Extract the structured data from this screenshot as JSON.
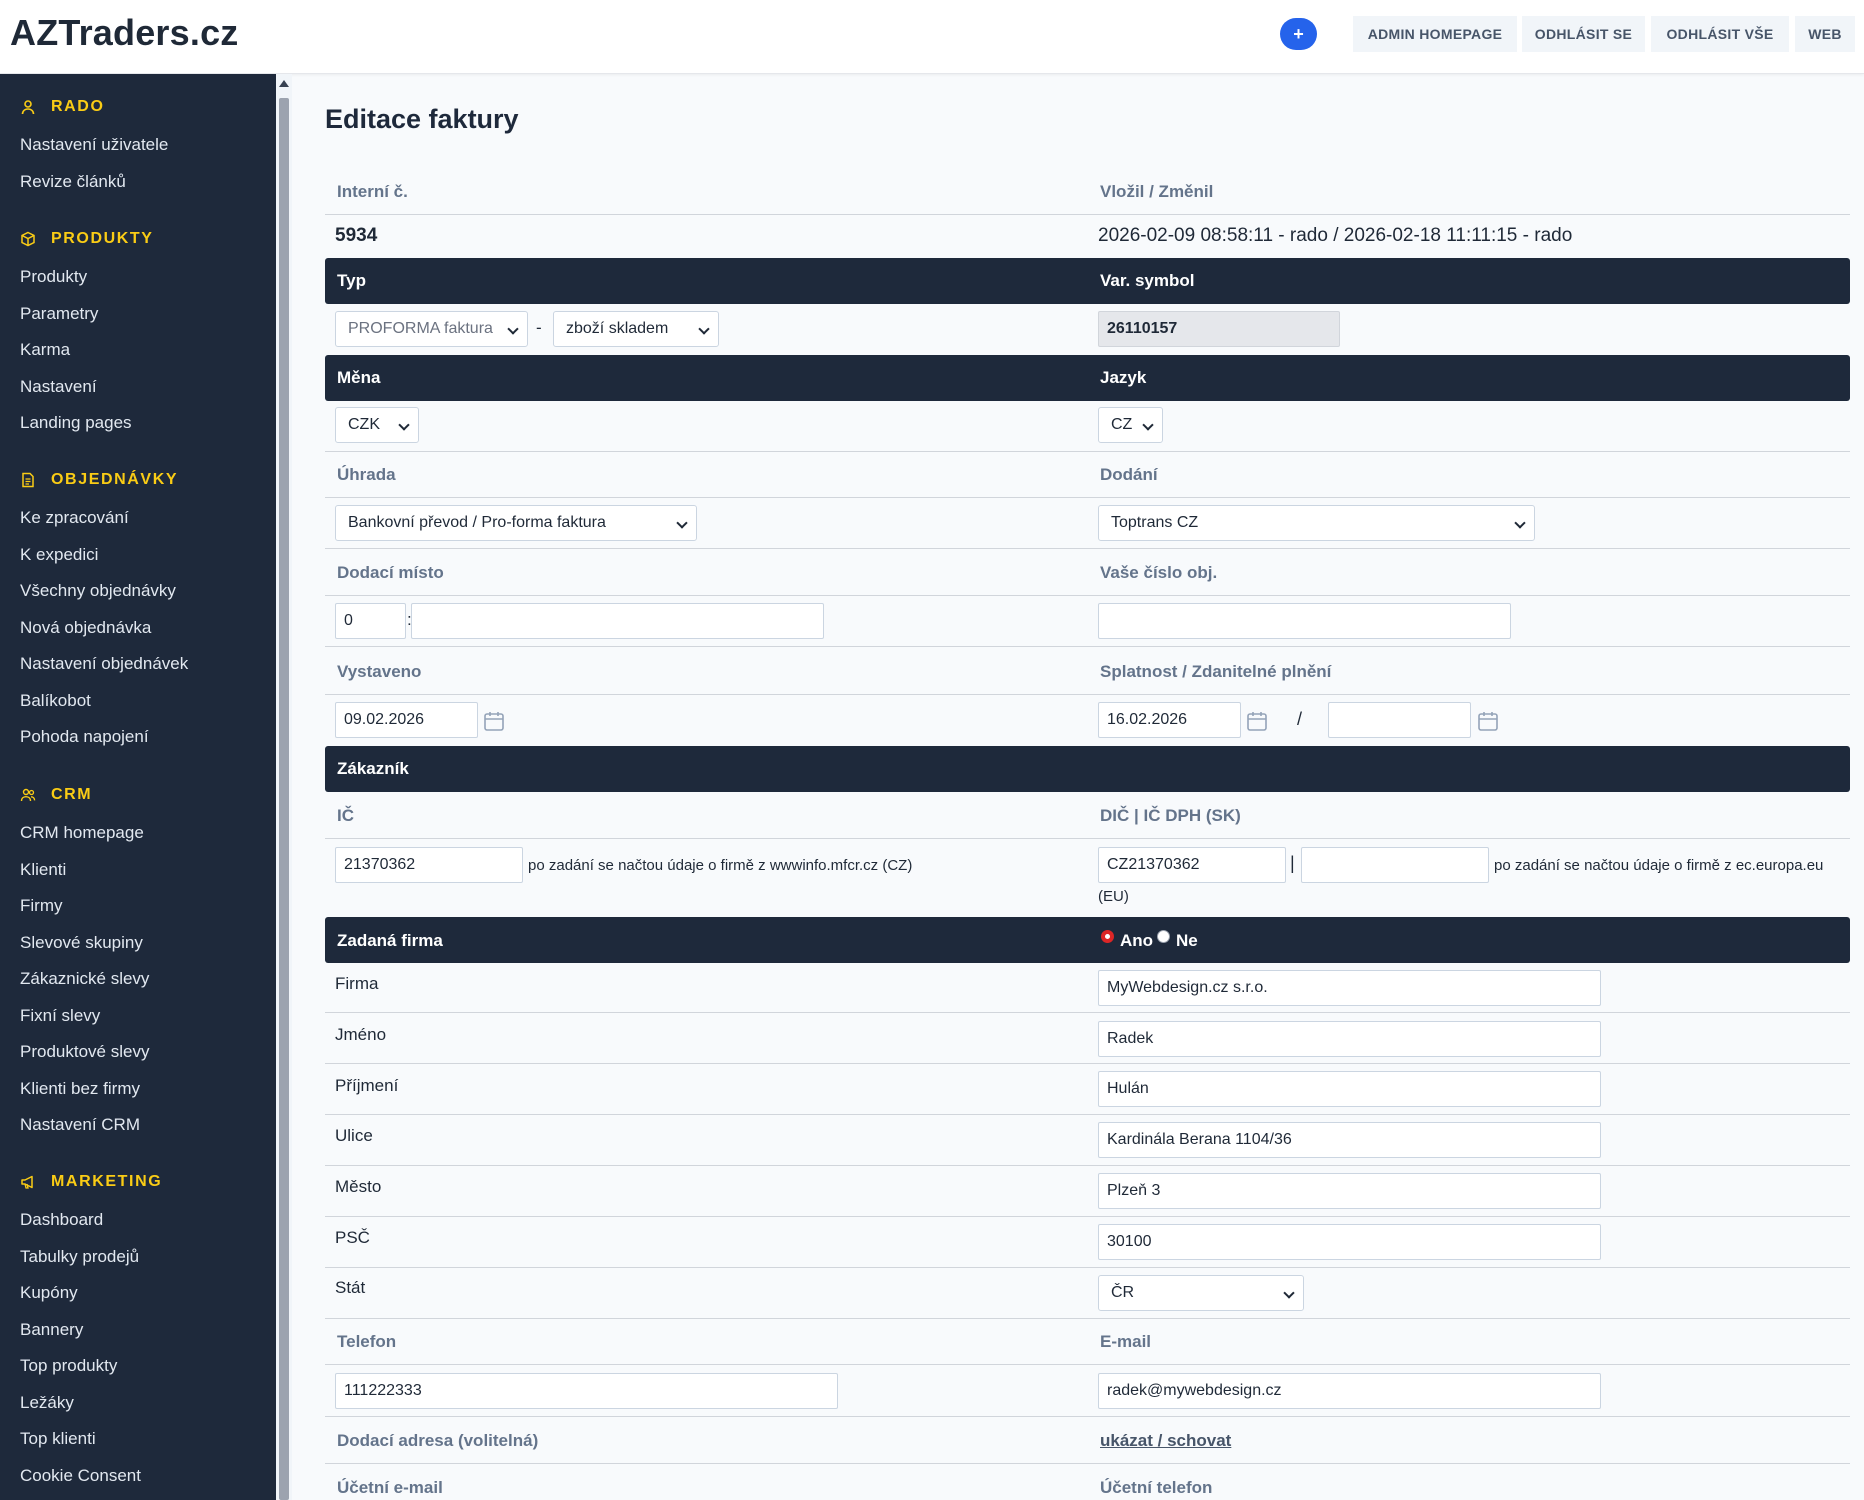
{
  "header": {
    "logo": "AZTraders.cz",
    "plus_label": "+",
    "links": [
      "ADMIN HOMEPAGE",
      "ODHLÁSIT SE",
      "ODHLÁSIT VŠE",
      "WEB"
    ]
  },
  "sidebar": {
    "sections": [
      {
        "title": "RADO",
        "icon": "user-icon",
        "items": [
          "Nastavení uživatele",
          "Revize článků"
        ]
      },
      {
        "title": "PRODUKTY",
        "icon": "box-icon",
        "items": [
          "Produkty",
          "Parametry",
          "Karma",
          "Nastavení",
          "Landing pages"
        ]
      },
      {
        "title": "OBJEDNÁVKY",
        "icon": "document-icon",
        "items": [
          "Ke zpracování",
          "K expedici",
          "Všechny objednávky",
          "Nová objednávka",
          "Nastavení objednávek",
          "Balíkobot",
          "Pohoda napojení"
        ]
      },
      {
        "title": "CRM",
        "icon": "users-icon",
        "items": [
          "CRM homepage",
          "Klienti",
          "Firmy",
          "Slevové skupiny",
          "Zákaznické slevy",
          "Fixní slevy",
          "Produktové slevy",
          "Klienti bez firmy",
          "Nastavení CRM"
        ]
      },
      {
        "title": "MARKETING",
        "icon": "megaphone-icon",
        "items": [
          "Dashboard",
          "Tabulky prodejů",
          "Kupóny",
          "Bannery",
          "Top produkty",
          "Ležáky",
          "Top klienti",
          "Cookie Consent"
        ]
      }
    ]
  },
  "form": {
    "title": "Editace faktury",
    "interni_label": "Interní č.",
    "vlozil_label": "Vložil / Změnil",
    "interni_value": "5934",
    "vlozil_value": "2026-02-09 08:58:11 - rado / 2026-02-18 11:11:15 - rado",
    "typ_label": "Typ",
    "var_symbol_label": "Var. symbol",
    "typ_value": "PROFORMA faktura",
    "dash": "-",
    "typ2_value": "zboží skladem",
    "var_symbol_value": "26110157",
    "mena_label": "Měna",
    "jazyk_label": "Jazyk",
    "mena_value": "CZK",
    "jazyk_value": "CZ",
    "uhrada_label": "Úhrada",
    "dodani_label": "Dodání",
    "uhrada_value": "Bankovní převod / Pro-forma faktura",
    "dodani_value": "Toptrans CZ",
    "dodaci_misto_label": "Dodací místo",
    "vase_cislo_label": "Vaše číslo obj.",
    "dodaci_misto_value": "0",
    "colon": ":",
    "dodaci_misto_text": "",
    "vase_cislo_value": "",
    "vystaveno_label": "Vystaveno",
    "splatnost_label": "Splatnost / Zdanitelné plnění",
    "vystaveno_value": "09.02.2026",
    "splatnost_value": "16.02.2026",
    "slash": "/",
    "zdanitelne_value": "",
    "zakaznik_label": "Zákazník",
    "ic_label": "IČ",
    "dic_label": "DIČ | IČ DPH (SK)",
    "ic_value": "21370362",
    "ic_hint": "po zadání se načtou údaje o firmě z wwwinfo.mfcr.cz (CZ)",
    "dic_value": "CZ21370362",
    "pipe": "|",
    "ic_dph_value": "",
    "dic_hint": "po zadání se načtou údaje o firmě z ec.europa.eu",
    "dic_hint2": "(EU)",
    "zadana_firma_label": "Zadaná firma",
    "ano_label": "Ano",
    "ne_label": "Ne",
    "firma_label": "Firma",
    "firma_value": "MyWebdesign.cz s.r.o.",
    "jmeno_label": "Jméno",
    "jmeno_value": "Radek",
    "prijmeni_label": "Příjmení",
    "prijmeni_value": "Hulán",
    "ulice_label": "Ulice",
    "ulice_value": "Kardinála Berana 1104/36",
    "mesto_label": "Město",
    "mesto_value": "Plzeň 3",
    "psc_label": "PSČ",
    "psc_value": "30100",
    "stat_label": "Stát",
    "stat_value": "ČR",
    "telefon_label": "Telefon",
    "email_label": "E-mail",
    "telefon_value": "111222333",
    "email_value": "radek@mywebdesign.cz",
    "dodaci_adresa_label": "Dodací adresa (volitelná)",
    "ukazat_link": "ukázat / schovat",
    "ucetni_email_label": "Účetní e-mail",
    "ucetni_telefon_label": "Účetní telefon"
  },
  "colors": {
    "sidebar_bg": "#1e293b",
    "section_title": "#facc15",
    "accent": "#2563eb",
    "bar_bg": "#1e293b",
    "radio_selected": "#dc2626"
  }
}
